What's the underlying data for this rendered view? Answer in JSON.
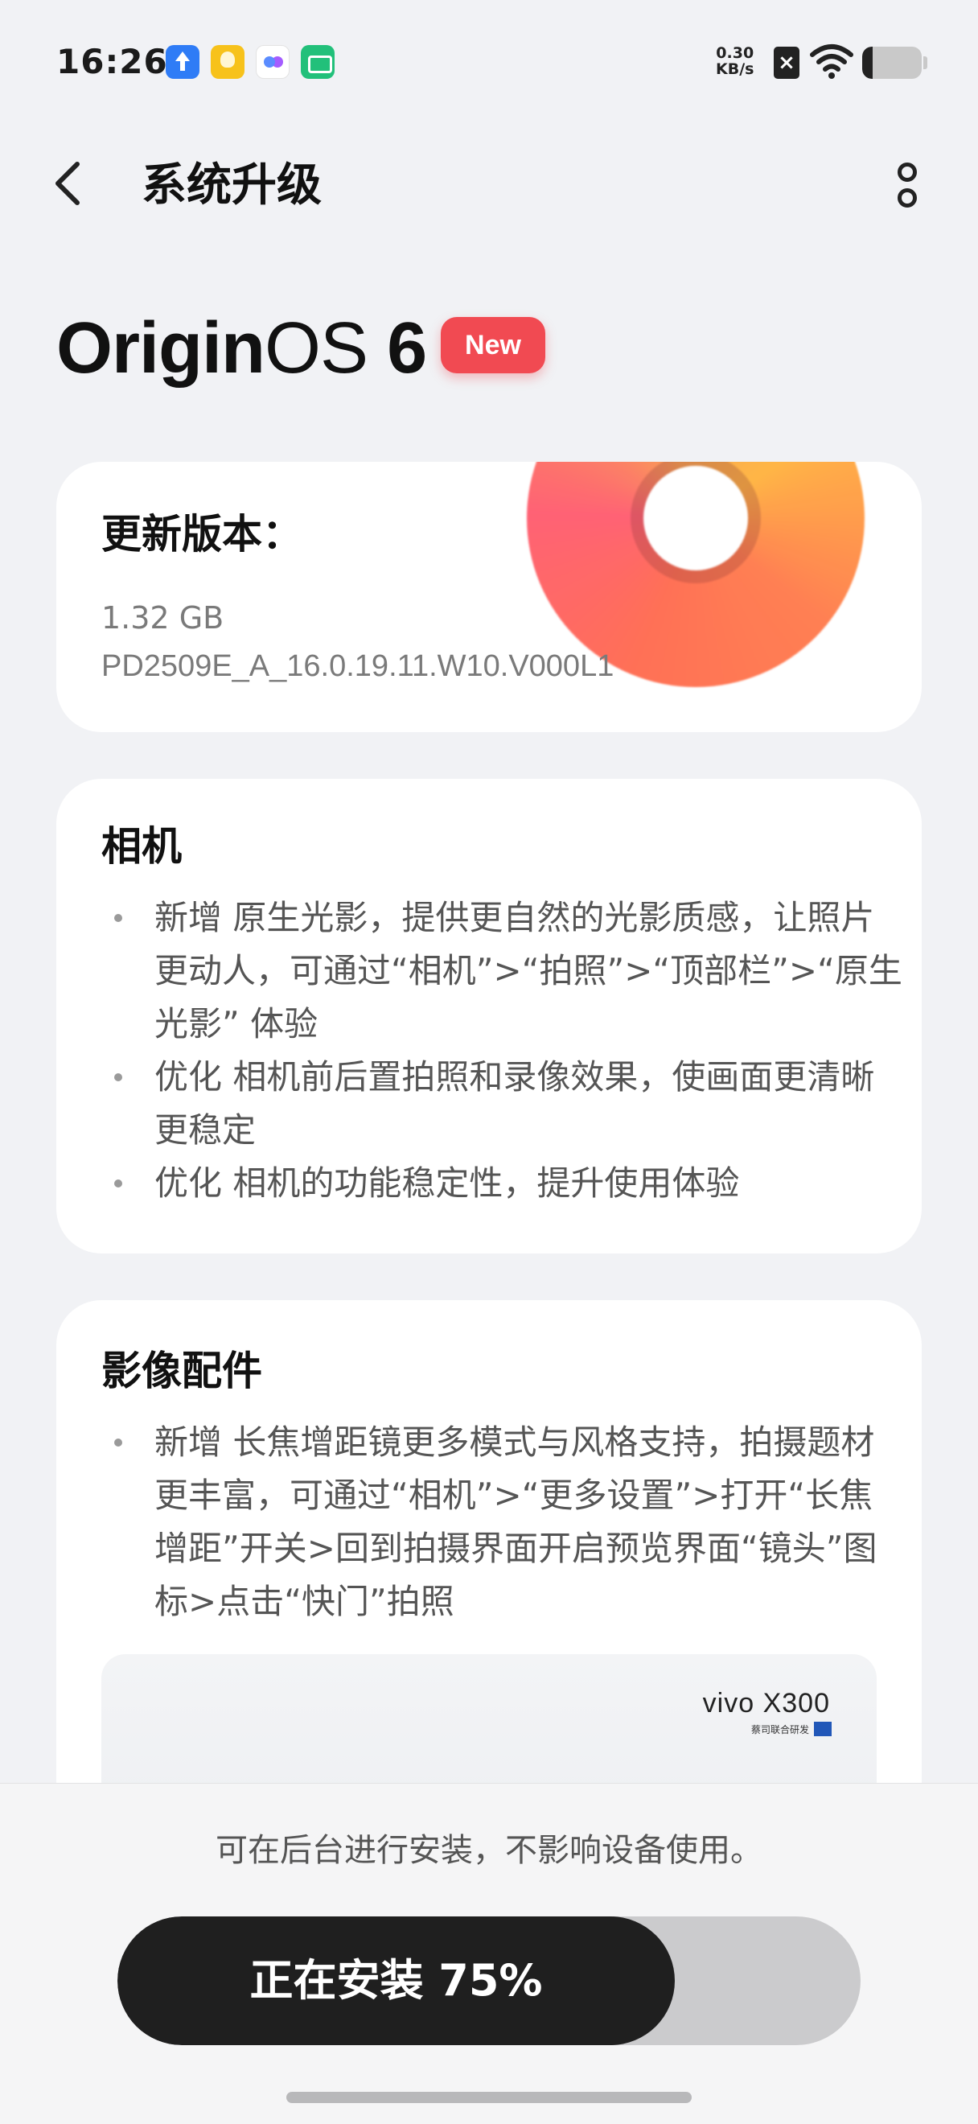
{
  "status_bar": {
    "time": "16:26",
    "network_speed_value": "0.30",
    "network_speed_unit": "KB/s",
    "battery_level": 0.18,
    "notification_icons": [
      "upload-icon",
      "lightbulb-icon",
      "chat-bubble-icon",
      "green-app-icon"
    ]
  },
  "header": {
    "title": "系统升级",
    "back_icon": "chevron-left-icon",
    "more_icon": "more-vertical-icon"
  },
  "os": {
    "name_bold": "Origin",
    "name_light": "OS",
    "version": "6",
    "badge": "New",
    "badge_color": "#f14a52"
  },
  "version_card": {
    "label": "更新版本：",
    "size": "1.32 GB",
    "build": "PD2509E_A_16.0.19.11.W10.V000L1"
  },
  "camera_card": {
    "title": "相机",
    "items": [
      "新增 原生光影，提供更自然的光影质感，让照片更动人，可通过“相机”>“拍照”>“顶部栏”>“原生光影” 体验",
      "优化 相机前后置拍照和录像效果，使画面更清晰更稳定",
      "优化 相机的功能稳定性，提升使用体验"
    ]
  },
  "imaging_card": {
    "title": "影像配件",
    "items": [
      "新增 长焦增距镜更多模式与风格支持，拍摄题材更丰富，可通过“相机”>“更多设置”>打开“长焦增距”开关>回到拍摄界面开启预览界面“镜头”图标>点击“快门”拍照"
    ],
    "promo_brand": "vivo X300",
    "promo_sub": "蔡司联合研发"
  },
  "install": {
    "note": "可在后台进行安装，不影响设备使用。",
    "label": "正在安装 75%",
    "progress": 0.75
  }
}
